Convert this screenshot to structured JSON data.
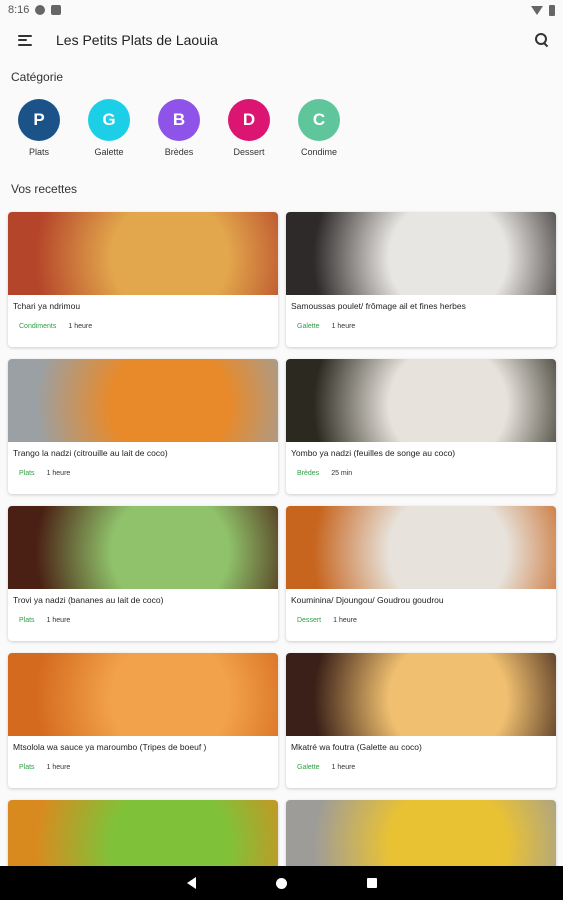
{
  "status": {
    "time": "8:16"
  },
  "appbar": {
    "title": "Les Petits Plats de Laouia"
  },
  "sections": {
    "categories": "Catégorie",
    "recipes": "Vos recettes"
  },
  "categories": [
    {
      "letter": "P",
      "label": "Plats",
      "color": "#1b5389"
    },
    {
      "letter": "G",
      "label": "Galette",
      "color": "#1ccfe6"
    },
    {
      "letter": "B",
      "label": "Brèdes",
      "color": "#8e54e9"
    },
    {
      "letter": "D",
      "label": "Dessert",
      "color": "#dc1573"
    },
    {
      "letter": "C",
      "label": "Condime",
      "color": "#5fc59a"
    }
  ],
  "recipes": [
    {
      "title": "Tchari ya ndrimou",
      "category": "Condiments",
      "time": "1 heure",
      "image_colors": [
        "#b5452a",
        "#e2a64c"
      ]
    },
    {
      "title": "Samoussas poulet/ frômage ail et fines herbes",
      "category": "Galette",
      "time": "1 heure",
      "image_colors": [
        "#2f2a2a",
        "#e8e6e2"
      ]
    },
    {
      "title": "Trango la nadzi (citrouille au lait de coco)",
      "category": "Plats",
      "time": "1 heure",
      "image_colors": [
        "#9aa0a4",
        "#e88a2a"
      ]
    },
    {
      "title": "Yombo ya nadzi (feuilles de songe au coco)",
      "category": "Brèdes",
      "time": "25 min",
      "image_colors": [
        "#2c2a20",
        "#e7e3dc"
      ]
    },
    {
      "title": "Trovi ya nadzi (bananes au lait de coco)",
      "category": "Plats",
      "time": "1 heure",
      "image_colors": [
        "#4a1f14",
        "#8fc26a"
      ]
    },
    {
      "title": "Kouminina/ Djoungou/ Goudrou goudrou",
      "category": "Dessert",
      "time": "1 heure",
      "image_colors": [
        "#c7651f",
        "#e7e3dc"
      ]
    },
    {
      "title": "Mtsolola wa sauce ya maroumbo (Tripes de boeuf )",
      "category": "Plats",
      "time": "1 heure",
      "image_colors": [
        "#d46a1e",
        "#f2a24a"
      ]
    },
    {
      "title": "Mkatré wa foutra (Galette au coco)",
      "category": "Galette",
      "time": "1 heure",
      "image_colors": [
        "#3a2018",
        "#f0c070"
      ]
    },
    {
      "title": "",
      "category": "",
      "time": "",
      "image_colors": [
        "#d98a1f",
        "#7fc23a"
      ]
    },
    {
      "title": "",
      "category": "",
      "time": "",
      "image_colors": [
        "#9e9c98",
        "#e9c234"
      ]
    }
  ]
}
